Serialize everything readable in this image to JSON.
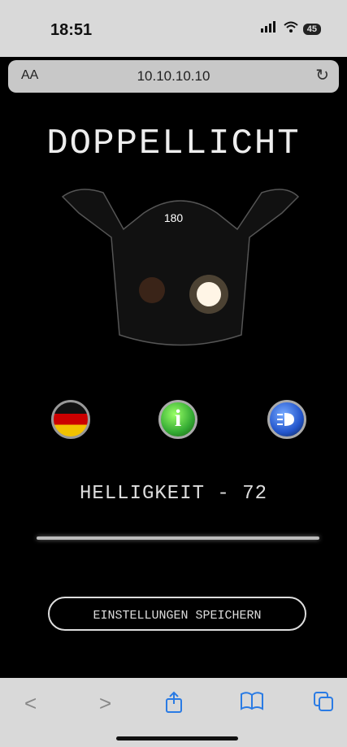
{
  "status": {
    "time": "18:51",
    "battery": "45"
  },
  "browser": {
    "aa_label": "AA",
    "url": "10.10.10.10"
  },
  "page": {
    "title": "DOPPELLICHT",
    "speed": "180",
    "brightness_label": "HELLIGKEIT - 72",
    "brightness_value": 72,
    "save_label": "EINSTELLUNGEN SPEICHERN"
  },
  "toolbar": {
    "back": "<",
    "forward": ">"
  }
}
